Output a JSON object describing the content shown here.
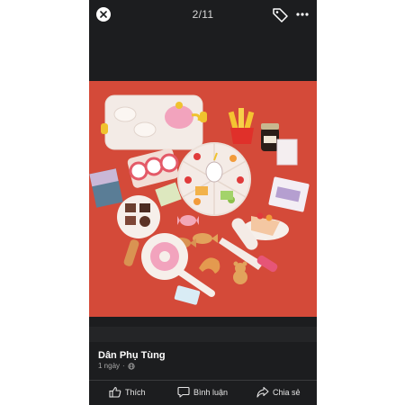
{
  "viewer": {
    "counter": "2/11",
    "icons": {
      "close": "close-icon",
      "tag": "tag-icon",
      "more": "more-dots-icon"
    }
  },
  "photo": {
    "subject": "toy bakery and dessert play set",
    "background_color": "#d44a39"
  },
  "post": {
    "author": "Dân Phụ Tùng",
    "time": "1 ngày",
    "separator": "·",
    "privacy_icon": "globe-icon"
  },
  "actions": {
    "like_label": "Thích",
    "comment_label": "Bình luận",
    "share_label": "Chia sẻ"
  }
}
